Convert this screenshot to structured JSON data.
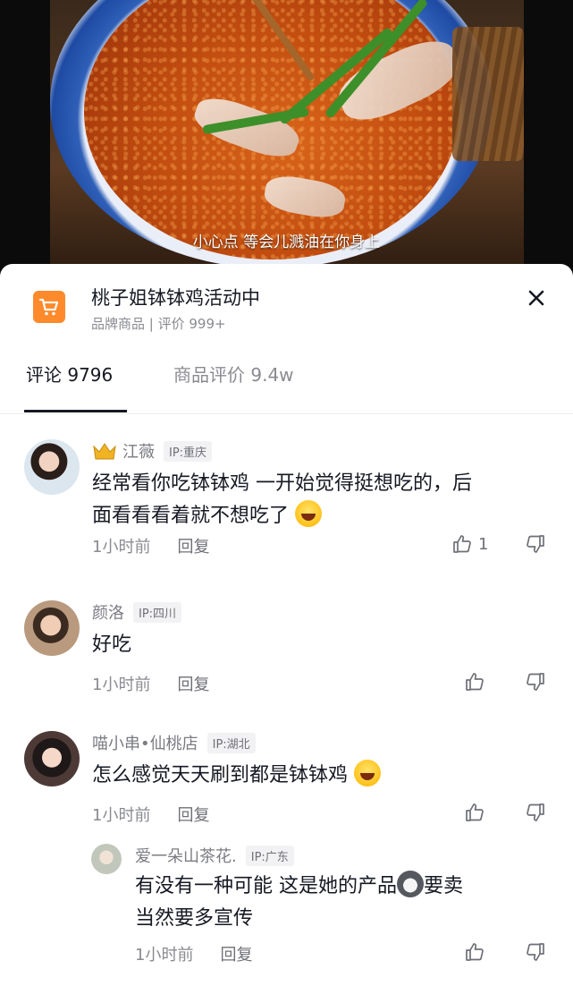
{
  "video": {
    "caption": "小心点  等会儿溅油在你身上"
  },
  "product": {
    "title": "桃子姐钵钵鸡活动中",
    "subtitle": "品牌商品 | 评价 999+",
    "icon": "shopping-cart-icon",
    "accent_color": "#ff8a2b"
  },
  "tabs": {
    "comments_label": "评论 9796",
    "reviews_label": "商品评价 9.4w"
  },
  "comments": [
    {
      "username": "江薇",
      "ip": "IP:重庆",
      "text_line1": "经常看你吃钵钵鸡 一开始觉得挺想吃的，后",
      "text_line2": "面看看看着就不想吃了",
      "time": "1小时前",
      "reply_label": "回复",
      "like_count": "1"
    },
    {
      "username": "颜洛",
      "ip": "IP:四川",
      "text_line1": "好吃",
      "time": "1小时前",
      "reply_label": "回复"
    },
    {
      "username": "喵小串•仙桃店",
      "ip": "IP:湖北",
      "text_line1": "怎么感觉天天刷到都是钵钵鸡",
      "time": "1小时前",
      "reply_label": "回复"
    },
    {
      "username": "爱一朵山茶花.",
      "ip": "IP:广东",
      "text_line1": "有没有一种可能 这是她的产品",
      "text_line1_tail": "要卖",
      "text_line2": "当然要多宣传",
      "time": "1小时前",
      "reply_label": "回复"
    }
  ]
}
